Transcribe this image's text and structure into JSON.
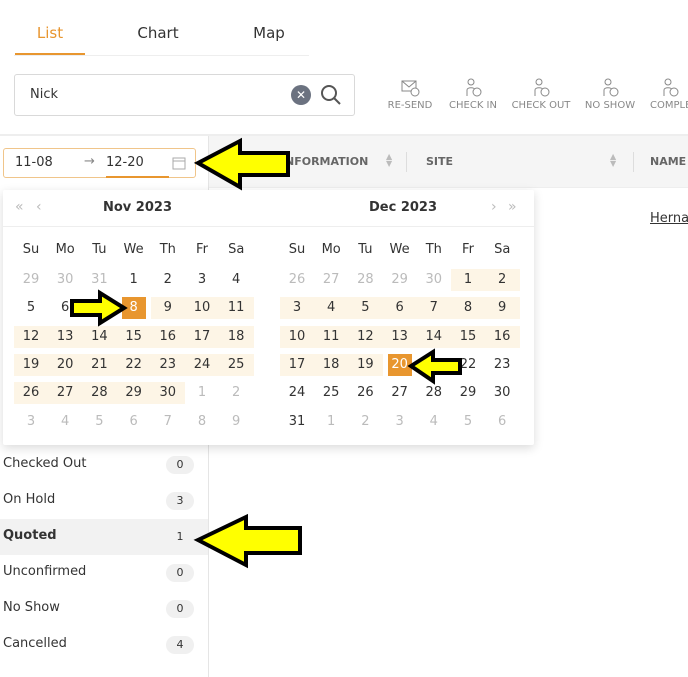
{
  "tabs": [
    {
      "label": "List",
      "active": true
    },
    {
      "label": "Chart"
    },
    {
      "label": "Map"
    }
  ],
  "search": {
    "value": "Nick",
    "clear_icon": "close-icon",
    "search_icon": "search-icon"
  },
  "toolbar": [
    {
      "label": "RE-SEND",
      "icon": "envelope-check-icon"
    },
    {
      "label": "CHECK IN",
      "icon": "person-arrow-down-icon"
    },
    {
      "label": "CHECK OUT",
      "icon": "person-arrow-up-icon"
    },
    {
      "label": "NO SHOW",
      "icon": "person-x-icon"
    },
    {
      "label": "COMPLE",
      "icon": "person-check-icon"
    }
  ],
  "table": {
    "headers": [
      "NFORMATION",
      "SITE",
      "NAME"
    ],
    "rows": [
      {
        "name": "Herna"
      }
    ]
  },
  "date_range": {
    "start": "11-08",
    "separator": "→",
    "end": "12-20"
  },
  "calendar": {
    "weekdays": [
      "Su",
      "Mo",
      "Tu",
      "We",
      "Th",
      "Fr",
      "Sa"
    ],
    "accent": "#e8962f",
    "range_color": "#fdf5e6",
    "months": [
      {
        "title": "Nov  2023",
        "selected": "8",
        "range_from": 8,
        "range_to": 30,
        "weeks": [
          [
            "29",
            "30",
            "31",
            "1",
            "2",
            "3",
            "4"
          ],
          [
            "5",
            "6",
            "7",
            "8",
            "9",
            "10",
            "11"
          ],
          [
            "12",
            "13",
            "14",
            "15",
            "16",
            "17",
            "18"
          ],
          [
            "19",
            "20",
            "21",
            "22",
            "23",
            "24",
            "25"
          ],
          [
            "26",
            "27",
            "28",
            "29",
            "30",
            "1",
            "2"
          ],
          [
            "3",
            "4",
            "5",
            "6",
            "7",
            "8",
            "9"
          ]
        ]
      },
      {
        "title": "Dec  2023",
        "selected": "20",
        "range_from": 1,
        "range_to": 20,
        "weeks": [
          [
            "26",
            "27",
            "28",
            "29",
            "30",
            "1",
            "2"
          ],
          [
            "3",
            "4",
            "5",
            "6",
            "7",
            "8",
            "9"
          ],
          [
            "10",
            "11",
            "12",
            "13",
            "14",
            "15",
            "16"
          ],
          [
            "17",
            "18",
            "19",
            "20",
            "21",
            "22",
            "23"
          ],
          [
            "24",
            "25",
            "26",
            "27",
            "28",
            "29",
            "30"
          ],
          [
            "31",
            "1",
            "2",
            "3",
            "4",
            "5",
            "6"
          ]
        ]
      }
    ]
  },
  "statuses": [
    {
      "label": "Checked Out",
      "count": "0"
    },
    {
      "label": "On Hold",
      "count": "3"
    },
    {
      "label": "Quoted",
      "count": "1",
      "active": true
    },
    {
      "label": "Unconfirmed",
      "count": "0"
    },
    {
      "label": "No Show",
      "count": "0"
    },
    {
      "label": "Cancelled",
      "count": "4"
    }
  ]
}
